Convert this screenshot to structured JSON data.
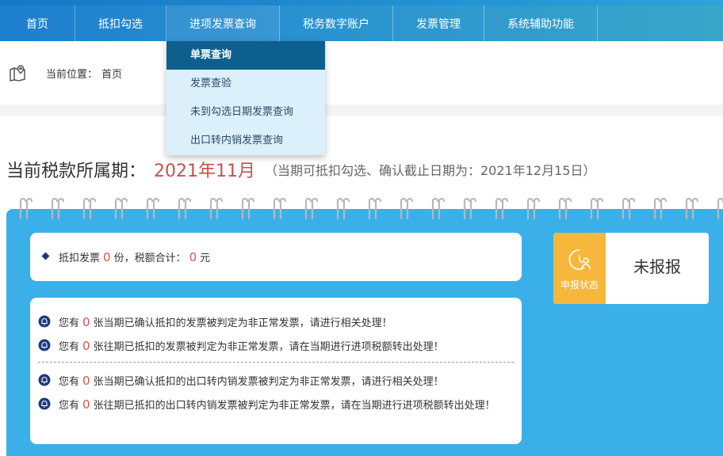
{
  "nav": {
    "items": [
      {
        "label": "首页"
      },
      {
        "label": "抵扣勾选"
      },
      {
        "label": "进项发票查询"
      },
      {
        "label": "税务数字账户"
      },
      {
        "label": "发票管理"
      },
      {
        "label": "系统辅助功能"
      }
    ],
    "dropdown": [
      {
        "label": "单票查询"
      },
      {
        "label": "发票查验"
      },
      {
        "label": "未到勾选日期发票查询"
      },
      {
        "label": "出口转内销发票查询"
      }
    ]
  },
  "breadcrumb": {
    "label": "当前位置：",
    "value": "首页"
  },
  "period": {
    "label": "当前税款所属期：",
    "value": "2021年11月",
    "note": "（当期可抵扣勾选、确认截止日期为：2021年12月15日）"
  },
  "summary": {
    "prefix": "抵扣发票",
    "count": "0",
    "count_unit": "份，税额合计：",
    "tax": "0",
    "tax_unit": "元"
  },
  "declare": {
    "badge_label": "申报状态",
    "value": "未报报"
  },
  "alerts": [
    {
      "pre": "您有",
      "count": "0",
      "post": "张当期已确认抵扣的发票被判定为非正常发票，请进行相关处理！"
    },
    {
      "pre": "您有",
      "count": "0",
      "post": "张往期已抵扣的发票被判定为非正常发票，请在当期进行进项税额转出处理！"
    },
    {
      "pre": "您有",
      "count": "0",
      "post": "张当期已确认抵扣的出口转内销发票被判定为非正常发票，请进行相关处理！"
    },
    {
      "pre": "您有",
      "count": "0",
      "post": "张往期已抵扣的出口转内销发票被判定为非正常发票，请在当期进行进项税额转出处理！"
    }
  ],
  "colors": {
    "accent": "#3bb0e8",
    "nav": "#1d7fce",
    "highlight": "#d9534f",
    "badge": "#f6b73c"
  }
}
